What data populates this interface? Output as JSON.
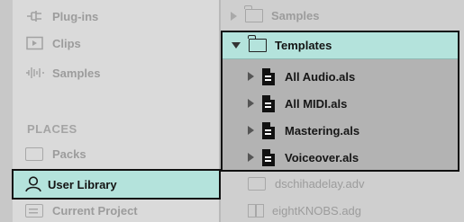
{
  "left": {
    "categories": [
      {
        "label": "Plug-ins",
        "icon": "plugin-icon"
      },
      {
        "label": "Clips",
        "icon": "clip-icon"
      },
      {
        "label": "Samples",
        "icon": "waveform-icon"
      }
    ],
    "places_heading": "PLACES",
    "places": [
      {
        "label": "Packs",
        "icon": "box-icon"
      },
      {
        "label": "User Library",
        "icon": "user-icon",
        "selected": true
      },
      {
        "label": "Current Project",
        "icon": "project-icon"
      }
    ]
  },
  "right": {
    "samples_folder": "Samples",
    "templates_folder": "Templates",
    "templates_files": [
      "All Audio.als",
      "All MIDI.als",
      "Mastering.als",
      "Voiceover.als"
    ],
    "other_files": [
      "dschihadelay.adv",
      "eightKNOBS.adg"
    ]
  },
  "colors": {
    "selection": "#b4e3dc",
    "left_bg": "#dadada",
    "right_bg": "#cfcfcf",
    "popout_bg": "#b3b3b3",
    "muted_text": "#9c9c9c"
  }
}
